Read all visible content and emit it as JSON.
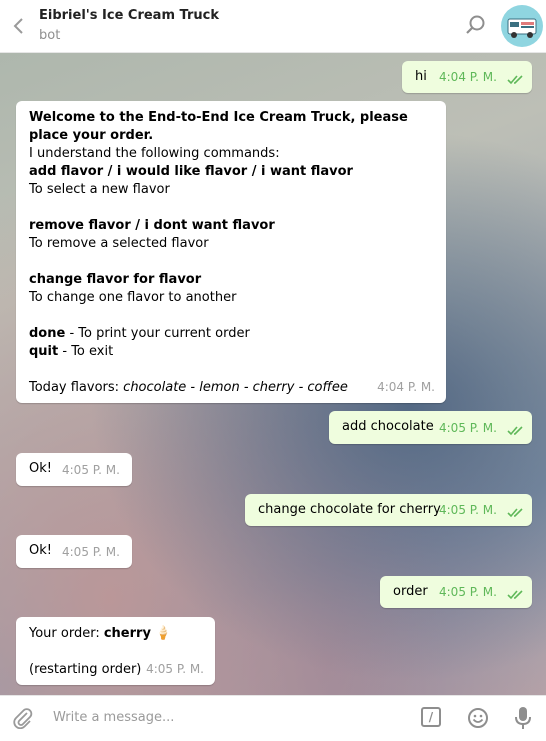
{
  "header": {
    "title": "Eibriel's Ice Cream Truck",
    "subtitle": "bot"
  },
  "messages": [
    {
      "from": "user",
      "text": "hi",
      "time": "4:04 P. M."
    },
    {
      "from": "bot",
      "welcome_line": "Welcome to the End-to-End Ice Cream Truck, please place your order.",
      "intro": "I understand the following commands:",
      "cmd_add": "add flavor / i would like flavor / i want flavor",
      "cmd_add_desc": "To select a new flavor",
      "cmd_remove": "remove flavor / i dont want flavor",
      "cmd_remove_desc": "To remove a selected flavor",
      "cmd_change": "change flavor for flavor",
      "cmd_change_desc": "To change one flavor to another",
      "cmd_done": "done",
      "cmd_done_desc": " - To print your current order",
      "cmd_quit": "quit",
      "cmd_quit_desc": " - To exit",
      "today_label": "Today flavors: ",
      "today_flavors": "chocolate - lemon - cherry - coffee",
      "time": "4:04 P. M."
    },
    {
      "from": "user",
      "text": "add chocolate",
      "time": "4:05 P. M."
    },
    {
      "from": "bot",
      "text": "Ok!",
      "time": "4:05 P. M."
    },
    {
      "from": "user",
      "text": "change chocolate for cherry",
      "time": "4:05 P. M."
    },
    {
      "from": "bot",
      "text": "Ok!",
      "time": "4:05 P. M."
    },
    {
      "from": "user",
      "text": "order",
      "time": "4:05 P. M."
    },
    {
      "from": "bot",
      "order_label": "Your order: ",
      "order_item": "cherry",
      "order_emoji": "🍦",
      "restart": "(restarting order)",
      "time": "4:05 P. M."
    }
  ],
  "composer": {
    "placeholder": "Write a message...",
    "command_symbol": "/"
  },
  "icons": {
    "back": "chevron-left-icon",
    "search": "search-icon",
    "attach": "paperclip-icon",
    "commands": "slash-command-icon",
    "emoji": "smiley-icon",
    "mic": "microphone-icon",
    "read": "double-check-icon"
  },
  "colors": {
    "outgoing_bubble": "#effdde",
    "incoming_bubble": "#ffffff",
    "read_tick": "#5fb859"
  }
}
